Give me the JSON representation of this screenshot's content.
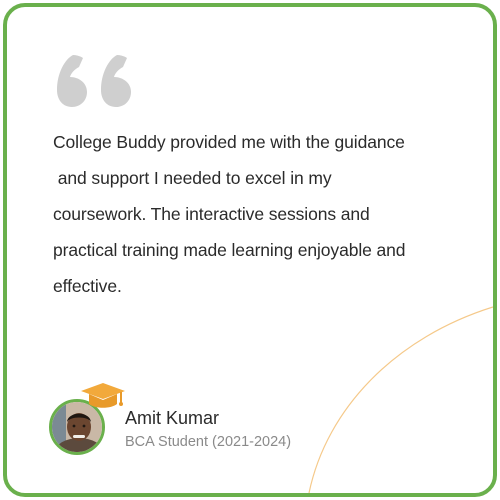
{
  "testimonial": {
    "quote_icon": "double-quote-icon",
    "quote_lines": [
      "College Buddy provided me with the guidance",
      " and support I needed to excel in my",
      "coursework. The interactive sessions and",
      "practical training made learning enjoyable and",
      "effective."
    ],
    "author": {
      "name": "Amit Kumar",
      "role": "BCA Student (2021-2024)",
      "badge_icon": "graduation-cap-icon"
    }
  },
  "colors": {
    "border": "#6ab04c",
    "quote_icon": "#cfcfcf",
    "text": "#2b2b2b",
    "subtext": "#8a8a8a",
    "cap": "#f2a93b",
    "arc": "#f5c98a"
  }
}
